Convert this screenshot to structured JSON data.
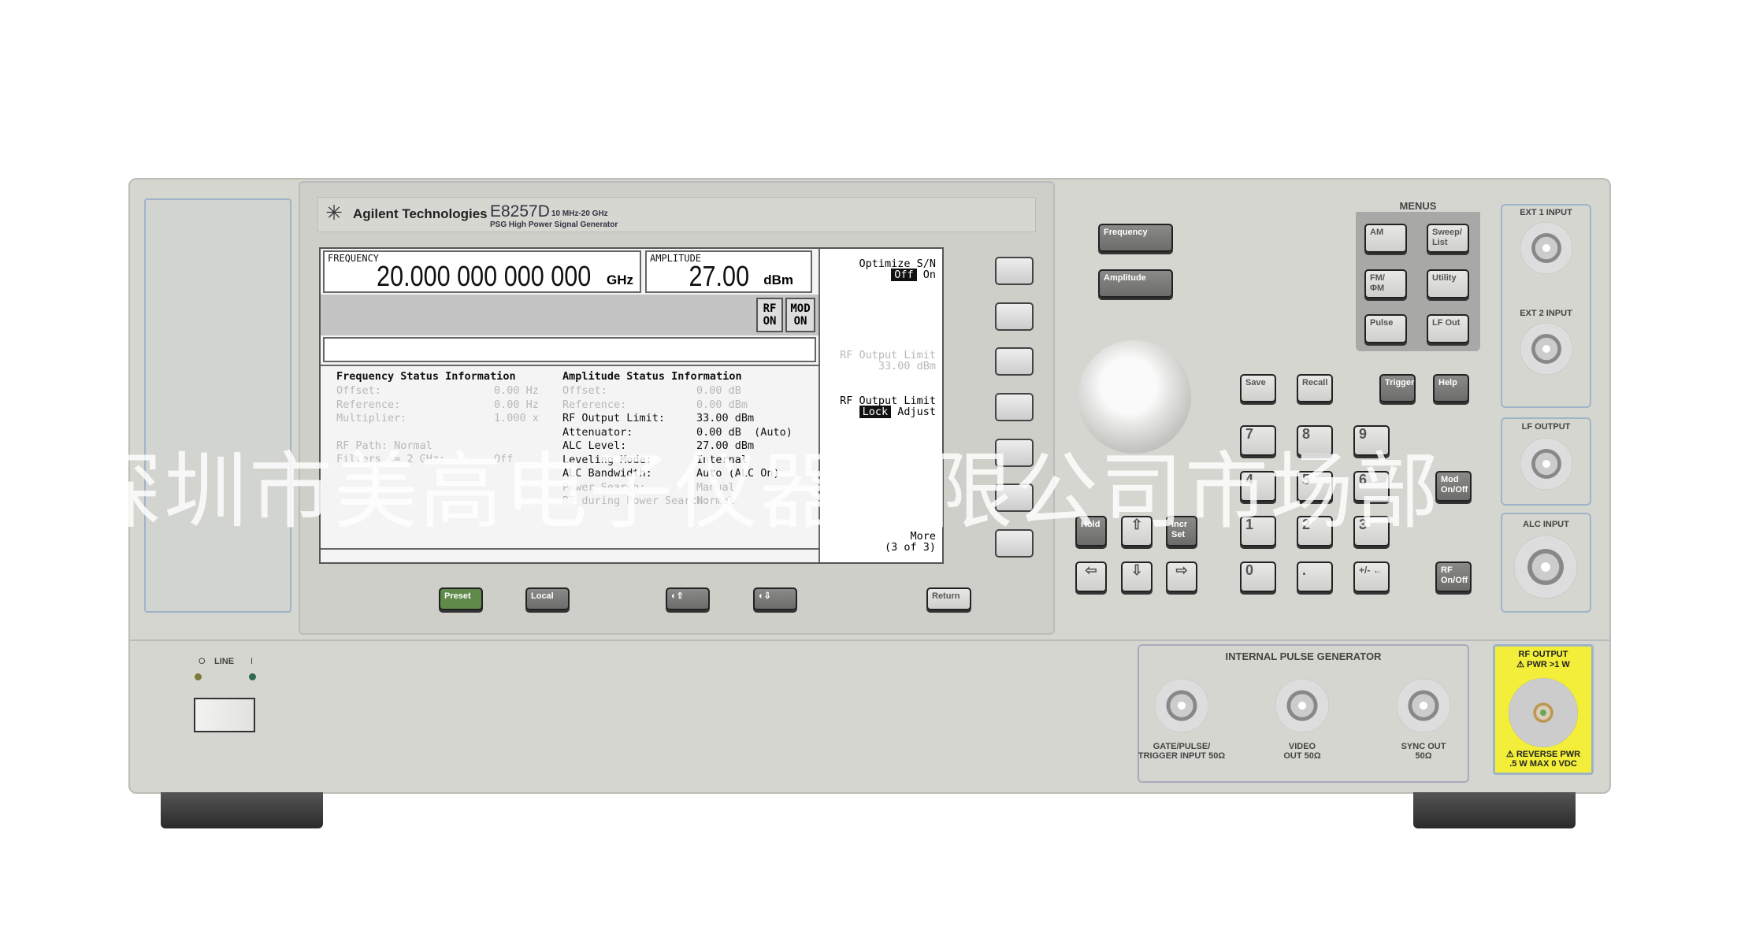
{
  "header": {
    "brand": "Agilent Technologies",
    "model": "E8257D",
    "range": "10 MHz-20 GHz",
    "description": "PSG High Power Signal Generator"
  },
  "display": {
    "frequency": {
      "label": "FREQUENCY",
      "value": "20.000 000 000 000",
      "unit": "GHz"
    },
    "amplitude": {
      "label": "AMPLITUDE",
      "value": "27.00",
      "unit": "dBm"
    },
    "indicators": [
      {
        "line1": "RF",
        "line2": "ON"
      },
      {
        "line1": "MOD",
        "line2": "ON"
      }
    ],
    "freq_status": {
      "title": "Frequency Status Information",
      "rows": [
        {
          "label": "Offset:",
          "value": "0.00 Hz",
          "dim": true
        },
        {
          "label": "Reference:",
          "value": "0.00 Hz",
          "dim": true
        },
        {
          "label": "Multiplier:",
          "value": "1.000 x",
          "dim": true
        },
        {
          "label": "RF Path: Normal",
          "value": "",
          "dim": true
        },
        {
          "label": "Filters <= 2 GHz:",
          "value": "Off",
          "dim": true
        }
      ]
    },
    "amp_status": {
      "title": "Amplitude Status Information",
      "rows": [
        {
          "label": "Offset:",
          "value": "0.00 dB",
          "dim": true
        },
        {
          "label": "Reference:",
          "value": "0.00 dBm",
          "dim": true
        },
        {
          "label": "RF Output Limit:",
          "value": "33.00 dBm",
          "dim": false
        },
        {
          "label": "Attenuator:",
          "value": "0.00 dB  (Auto)",
          "dim": false
        },
        {
          "label": "ALC Level:",
          "value": "27.00 dBm",
          "dim": false
        },
        {
          "label": "Leveling Mode:",
          "value": "Internal",
          "dim": false
        },
        {
          "label": "ALC Bandwidth:",
          "value": "Auto (ALC On)",
          "dim": false
        },
        {
          "label": "Power Search:",
          "value": "Manual",
          "dim": true
        },
        {
          "label": "RF during Power Search:",
          "value": "Normal",
          "dim": true
        }
      ]
    },
    "softkeys": {
      "optimize": {
        "title": "Optimize S/N",
        "selected": "Off",
        "other": "On"
      },
      "rf_limit_value": {
        "title": "RF Output Limit",
        "value": "33.00 dBm"
      },
      "rf_limit_mode": {
        "title": "RF Output Limit",
        "selected": "Lock",
        "other": "Adjust"
      },
      "more": {
        "line1": "More",
        "line2": "(3 of 3)"
      }
    }
  },
  "bezel_keys": {
    "preset": "Preset",
    "local": "Local",
    "contrast_up": "◐⇧",
    "contrast_down": "◐⇩",
    "return": "Return"
  },
  "keys": {
    "frequency": "Frequency",
    "amplitude": "Amplitude",
    "menus_title": "MENUS",
    "menus": [
      "AM",
      "Sweep/ List",
      "FM/ ΦM",
      "Utility",
      "Pulse",
      "LF Out"
    ],
    "save": "Save",
    "recall": "Recall",
    "trigger": "Trigger",
    "help": "Help",
    "keypad": [
      "7",
      "8",
      "9",
      "4",
      "5",
      "6",
      "1",
      "2",
      "3",
      "0",
      ".",
      "+/- ←"
    ],
    "hold": "Hold",
    "incr_set": "Incr Set",
    "mod_onoff": "Mod On/Off",
    "rf_onoff": "RF On/Off"
  },
  "connectors": {
    "ext1": "EXT 1 INPUT",
    "ext2": "EXT 2 INPUT",
    "lf_output": "LF OUTPUT",
    "alc_input": "ALC INPUT",
    "pulse_gen": "INTERNAL PULSE GENERATOR",
    "gate": "GATE/PULSE/ TRIGGER INPUT 50Ω",
    "video": "VIDEO OUT 50Ω",
    "sync": "SYNC OUT 50Ω",
    "rf_output": "RF OUTPUT",
    "rf_warn": "PWR >1 W",
    "reverse": "REVERSE PWR",
    "reverse2": ".5 W MAX 0 VDC"
  },
  "power": {
    "label": "LINE",
    "off": "O",
    "on": "I"
  },
  "watermark": "深圳市美高电子仪器有限公司市场部",
  "colors": {
    "preset": "#5f8a4a",
    "rf_warning": "#f2ee3a"
  }
}
